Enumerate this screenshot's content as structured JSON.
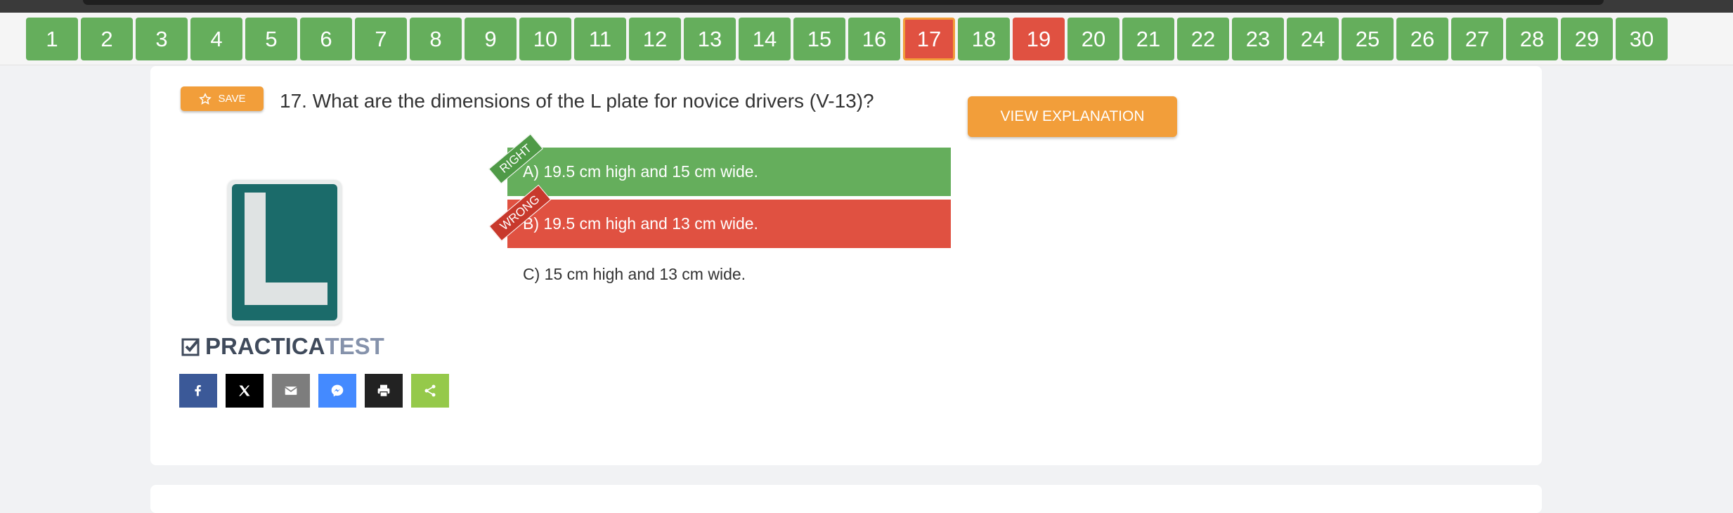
{
  "nav": {
    "questions": [
      {
        "label": "1",
        "status": "right"
      },
      {
        "label": "2",
        "status": "right"
      },
      {
        "label": "3",
        "status": "right"
      },
      {
        "label": "4",
        "status": "right"
      },
      {
        "label": "5",
        "status": "right"
      },
      {
        "label": "6",
        "status": "right"
      },
      {
        "label": "7",
        "status": "right"
      },
      {
        "label": "8",
        "status": "right"
      },
      {
        "label": "9",
        "status": "right"
      },
      {
        "label": "10",
        "status": "right"
      },
      {
        "label": "11",
        "status": "right"
      },
      {
        "label": "12",
        "status": "right"
      },
      {
        "label": "13",
        "status": "right"
      },
      {
        "label": "14",
        "status": "right"
      },
      {
        "label": "15",
        "status": "right"
      },
      {
        "label": "16",
        "status": "right"
      },
      {
        "label": "17",
        "status": "current"
      },
      {
        "label": "18",
        "status": "right"
      },
      {
        "label": "19",
        "status": "wrong"
      },
      {
        "label": "20",
        "status": "right"
      },
      {
        "label": "21",
        "status": "right"
      },
      {
        "label": "22",
        "status": "right"
      },
      {
        "label": "23",
        "status": "right"
      },
      {
        "label": "24",
        "status": "right"
      },
      {
        "label": "25",
        "status": "right"
      },
      {
        "label": "26",
        "status": "right"
      },
      {
        "label": "27",
        "status": "right"
      },
      {
        "label": "28",
        "status": "right"
      },
      {
        "label": "29",
        "status": "right"
      },
      {
        "label": "30",
        "status": "right"
      }
    ]
  },
  "question": {
    "save_label": "SAVE",
    "text": "17. What are the dimensions of the L plate for novice drivers (V-13)?",
    "explain_label": "VIEW EXPLANATION",
    "answers": [
      {
        "text": "A) 19.5 cm high and 15 cm wide.",
        "status": "right",
        "ribbon": "RIGHT"
      },
      {
        "text": "B) 19.5 cm high and 13 cm wide.",
        "status": "wrong",
        "ribbon": "WRONG"
      },
      {
        "text": "C) 15 cm high and 13 cm wide.",
        "status": "neutral",
        "ribbon": ""
      }
    ]
  },
  "brand": {
    "part1": "PRACTICA",
    "part2": "TEST"
  },
  "share": [
    {
      "icon": "facebook-icon",
      "color": "#3b5998"
    },
    {
      "icon": "x-icon",
      "color": "#000000"
    },
    {
      "icon": "email-icon",
      "color": "#7d7d7d"
    },
    {
      "icon": "messenger-icon",
      "color": "#448aff"
    },
    {
      "icon": "print-icon",
      "color": "#222222"
    },
    {
      "icon": "share-icon",
      "color": "#95c94a"
    }
  ],
  "colors": {
    "right": "#65ae5c",
    "wrong": "#e05141",
    "accent": "#f29e3a"
  }
}
